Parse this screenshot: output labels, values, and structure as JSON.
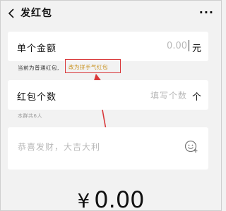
{
  "header": {
    "title": "发红包",
    "more_label": "···"
  },
  "amount_row": {
    "label": "单个金额",
    "value": "0.00",
    "unit": "元"
  },
  "notice": {
    "text": "当前为普通红包,",
    "link": "改为拼手气红包"
  },
  "count_row": {
    "label": "红包个数",
    "placeholder": "填写个数",
    "unit": "个"
  },
  "group_note": "本群共6人",
  "greeting": {
    "placeholder": "恭喜发财，大吉大利"
  },
  "total": {
    "currency": "¥",
    "amount": "0.00"
  },
  "colors": {
    "background": "#f2f2f2",
    "link": "#c8901a",
    "annotation": "#d9383a"
  }
}
